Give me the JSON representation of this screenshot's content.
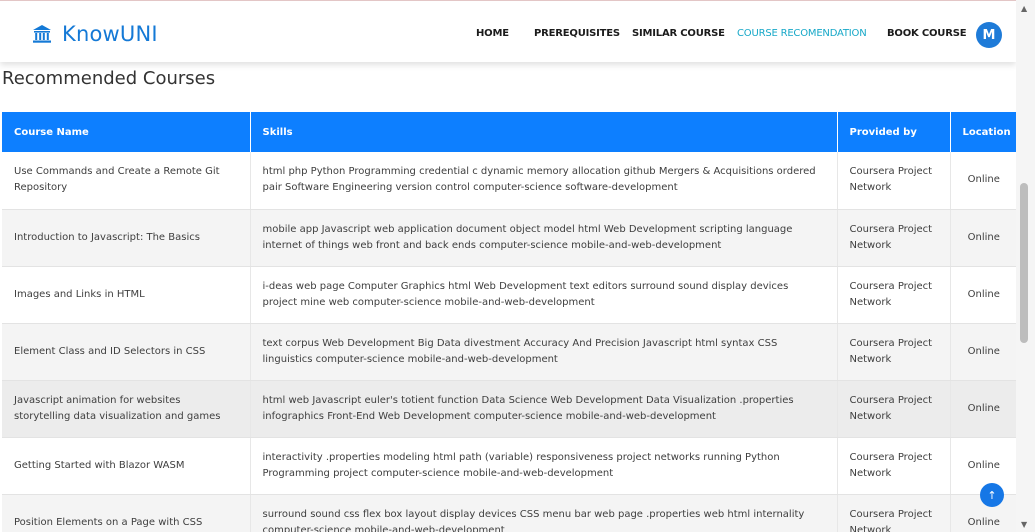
{
  "brand": {
    "name": "KnowUNI",
    "logo_icon": "university-building-icon",
    "color": "#1479d6"
  },
  "nav": {
    "items": [
      {
        "label": "HOME",
        "active": false
      },
      {
        "label": "PREREQUISITES",
        "active": false
      },
      {
        "label": "SIMILAR COURSE",
        "active": false
      },
      {
        "label": "COURSE RECOMENDATION",
        "active": true
      },
      {
        "label": "BOOK COURSE",
        "active": false
      }
    ],
    "avatar_initial": "M",
    "active_color": "#17a8c8"
  },
  "page": {
    "title": "Recommended Courses"
  },
  "table": {
    "headers": {
      "name": "Course Name",
      "skills": "Skills",
      "provider": "Provided by",
      "location": "Location"
    },
    "header_color": "#0d7fff",
    "rows": [
      {
        "name": "Use Commands and Create a Remote Git Repository",
        "skills": "html php Python Programming credential c dynamic memory allocation github Mergers & Acquisitions ordered pair Software Engineering version control computer-science software-development",
        "provider": "Coursera Project Network",
        "location": "Online"
      },
      {
        "name": "Introduction to Javascript: The Basics",
        "skills": "mobile app Javascript web application document object model html Web Development scripting language internet of things web front and back ends computer-science mobile-and-web-development",
        "provider": "Coursera Project Network",
        "location": "Online"
      },
      {
        "name": "Images and Links in HTML",
        "skills": "i-deas web page Computer Graphics html Web Development text editors surround sound display devices project mine web computer-science mobile-and-web-development",
        "provider": "Coursera Project Network",
        "location": "Online"
      },
      {
        "name": "Element Class and ID Selectors in CSS",
        "skills": "text corpus Web Development Big Data divestment Accuracy And Precision Javascript html syntax CSS linguistics computer-science mobile-and-web-development",
        "provider": "Coursera Project Network",
        "location": "Online"
      },
      {
        "name": "Javascript animation for websites storytelling data visualization and games",
        "skills": "html web Javascript euler's totient function Data Science Web Development Data Visualization .properties infographics Front-End Web Development computer-science mobile-and-web-development",
        "provider": "Coursera Project Network",
        "location": "Online"
      },
      {
        "name": "Getting Started with Blazor WASM",
        "skills": "interactivity .properties modeling html path (variable) responsiveness project networks running Python Programming project computer-science mobile-and-web-development",
        "provider": "Coursera Project Network",
        "location": "Online"
      },
      {
        "name": "Position Elements on a Page with CSS",
        "skills": "surround sound css flex box layout display devices CSS menu bar web page .properties web html internality computer-science mobile-and-web-development",
        "provider": "Coursera Project Network",
        "location": "Online"
      }
    ]
  },
  "scrollbar": {
    "up_icon": "arrow-up-icon",
    "down_icon": "arrow-down-icon"
  },
  "back_to_top": {
    "icon": "arrow-up-icon"
  }
}
